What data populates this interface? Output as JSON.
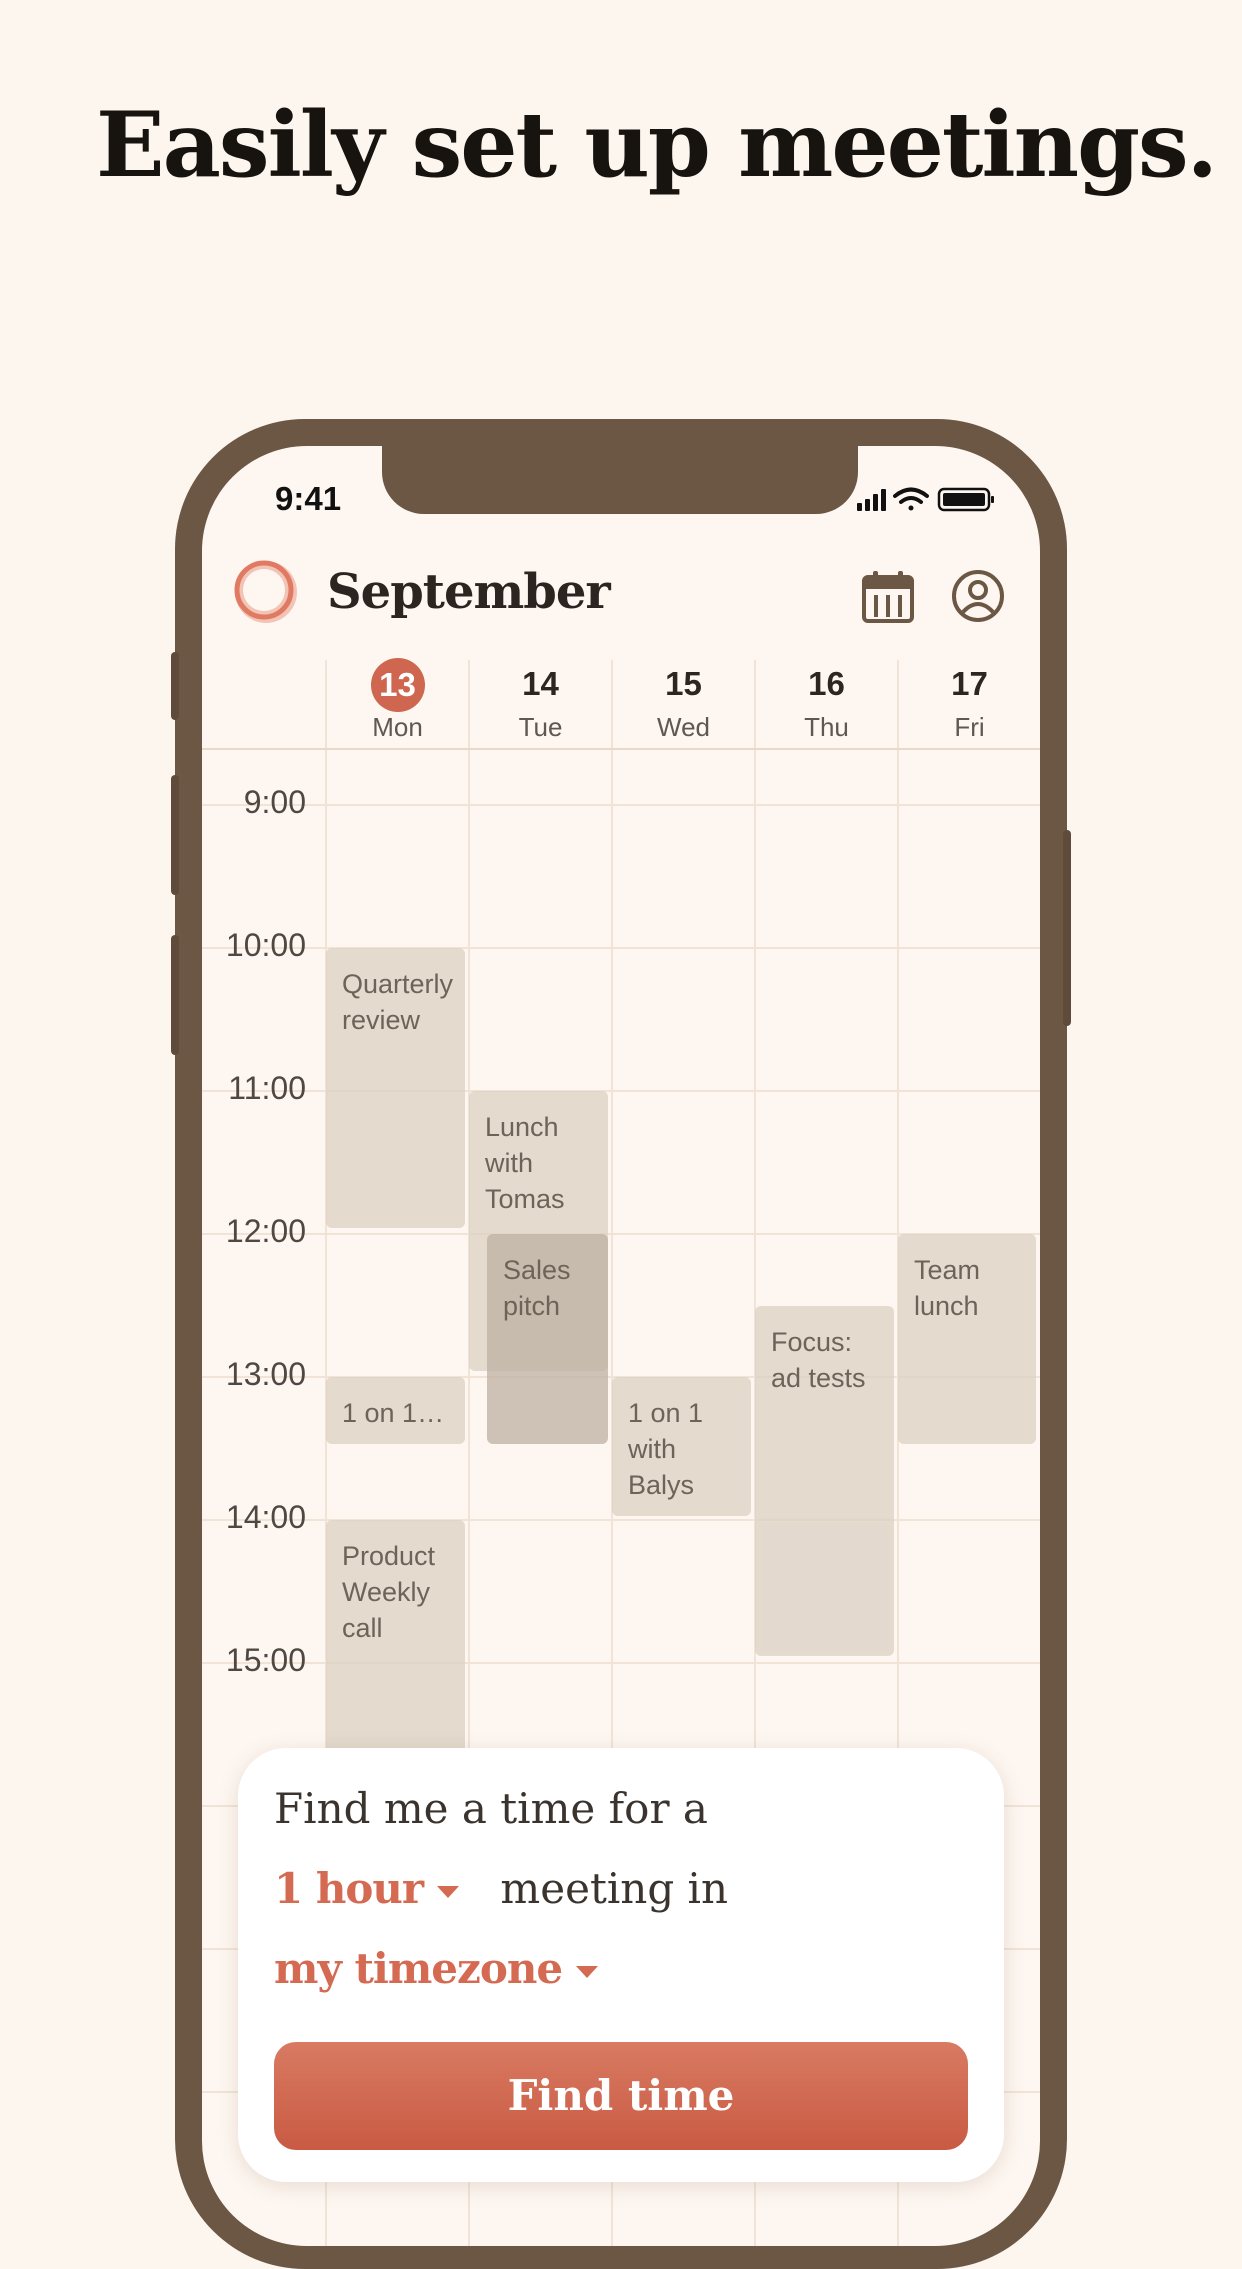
{
  "headline": "Easily set up meetings.",
  "status": {
    "time": "9:41"
  },
  "header": {
    "month": "September",
    "calendar_icon": "calendar-icon",
    "profile_icon": "profile-icon"
  },
  "days": [
    {
      "num": "13",
      "name": "Mon",
      "today": true
    },
    {
      "num": "14",
      "name": "Tue",
      "today": false
    },
    {
      "num": "15",
      "name": "Wed",
      "today": false
    },
    {
      "num": "16",
      "name": "Thu",
      "today": false
    },
    {
      "num": "17",
      "name": "Fri",
      "today": false
    }
  ],
  "hours": [
    "9:00",
    "10:00",
    "11:00",
    "12:00",
    "13:00",
    "14:00",
    "15:00"
  ],
  "events": [
    {
      "title": "Quarterly review",
      "day": "Mon"
    },
    {
      "title": "Lunch with Tomas",
      "day": "Tue"
    },
    {
      "title": "Sales pitch",
      "day": "Tue"
    },
    {
      "title": "Team lunch",
      "day": "Fri"
    },
    {
      "title": "Focus: ad tests",
      "day": "Thu"
    },
    {
      "title": "1 on 1 w...",
      "day": "Mon"
    },
    {
      "title": "1 on 1 with Balys",
      "day": "Wed"
    },
    {
      "title": "Product Weekly call",
      "day": "Mon"
    }
  ],
  "finder": {
    "line1": "Find me a time for a",
    "duration": "1 hour",
    "line2": "meeting in",
    "timezone": "my timezone",
    "button": "Find time"
  },
  "colors": {
    "accent": "#d46a52",
    "phone_frame": "#6b5744",
    "background": "#fdf6ef"
  }
}
